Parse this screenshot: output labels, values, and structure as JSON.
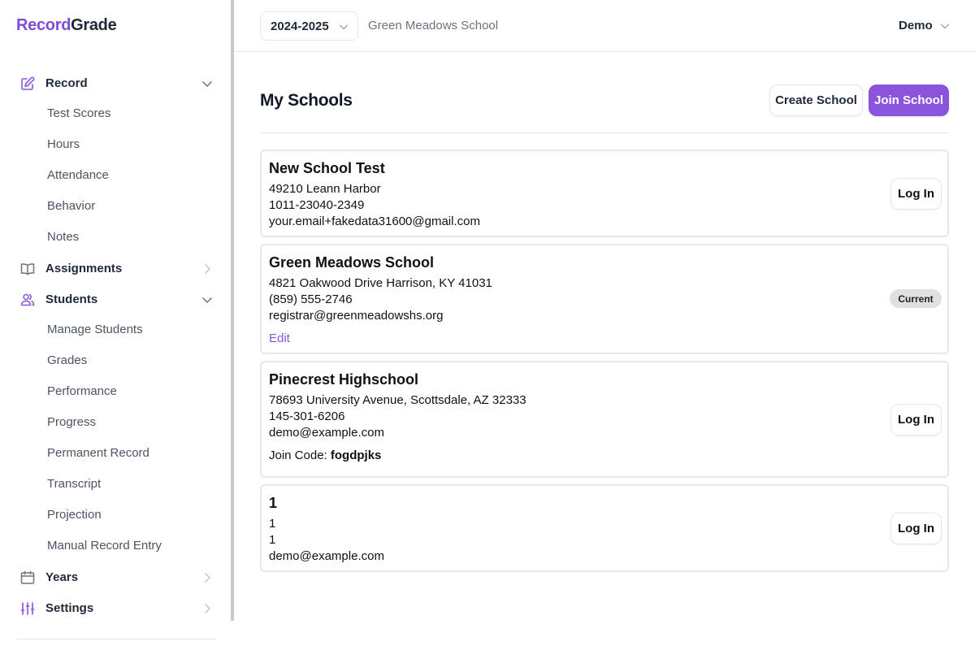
{
  "brand": {
    "part1": "Record",
    "part2": "Grade",
    "color": "#7c4ddb"
  },
  "sidebar": {
    "groups": [
      {
        "label": "Record",
        "icon": "pencil-square-icon",
        "expanded": true,
        "items": [
          "Test Scores",
          "Hours",
          "Attendance",
          "Behavior",
          "Notes"
        ]
      },
      {
        "label": "Assignments",
        "icon": "book-open-icon",
        "expanded": false,
        "items": []
      },
      {
        "label": "Students",
        "icon": "users-icon",
        "expanded": true,
        "items": [
          "Manage Students",
          "Grades",
          "Performance",
          "Progress",
          "Permanent Record",
          "Transcript",
          "Projection",
          "Manual Record Entry"
        ]
      },
      {
        "label": "Years",
        "icon": "calendar-icon",
        "expanded": false,
        "items": []
      },
      {
        "label": "Settings",
        "icon": "sliders-icon",
        "expanded": false,
        "items": []
      }
    ]
  },
  "topbar": {
    "year": "2024-2025",
    "school": "Green Meadows School",
    "user": "Demo"
  },
  "main": {
    "title": "My Schools",
    "create_label": "Create School",
    "join_label": "Join School",
    "accent": "#8b54dd"
  },
  "schools": [
    {
      "name": "New School Test",
      "address": "49210 Leann Harbor",
      "phone": "1011-23040-2349",
      "email": "your.email+fakedata31600@gmail.com",
      "action": "Log In"
    },
    {
      "name": "Green Meadows School",
      "address": "4821 Oakwood Drive Harrison, KY 41031",
      "phone": "(859) 555-2746",
      "email": "registrar@greenmeadowshs.org",
      "edit": "Edit",
      "badge": "Current"
    },
    {
      "name": "Pinecrest Highschool",
      "address": "78693 University Avenue, Scottsdale, AZ 32333",
      "phone": "145-301-6206",
      "email": "demo@example.com",
      "join_code_label": "Join Code:",
      "join_code": "fogdpjks",
      "action": "Log In"
    },
    {
      "name": "1",
      "address": "1",
      "phone": "1",
      "email": "demo@example.com",
      "action": "Log In"
    }
  ]
}
